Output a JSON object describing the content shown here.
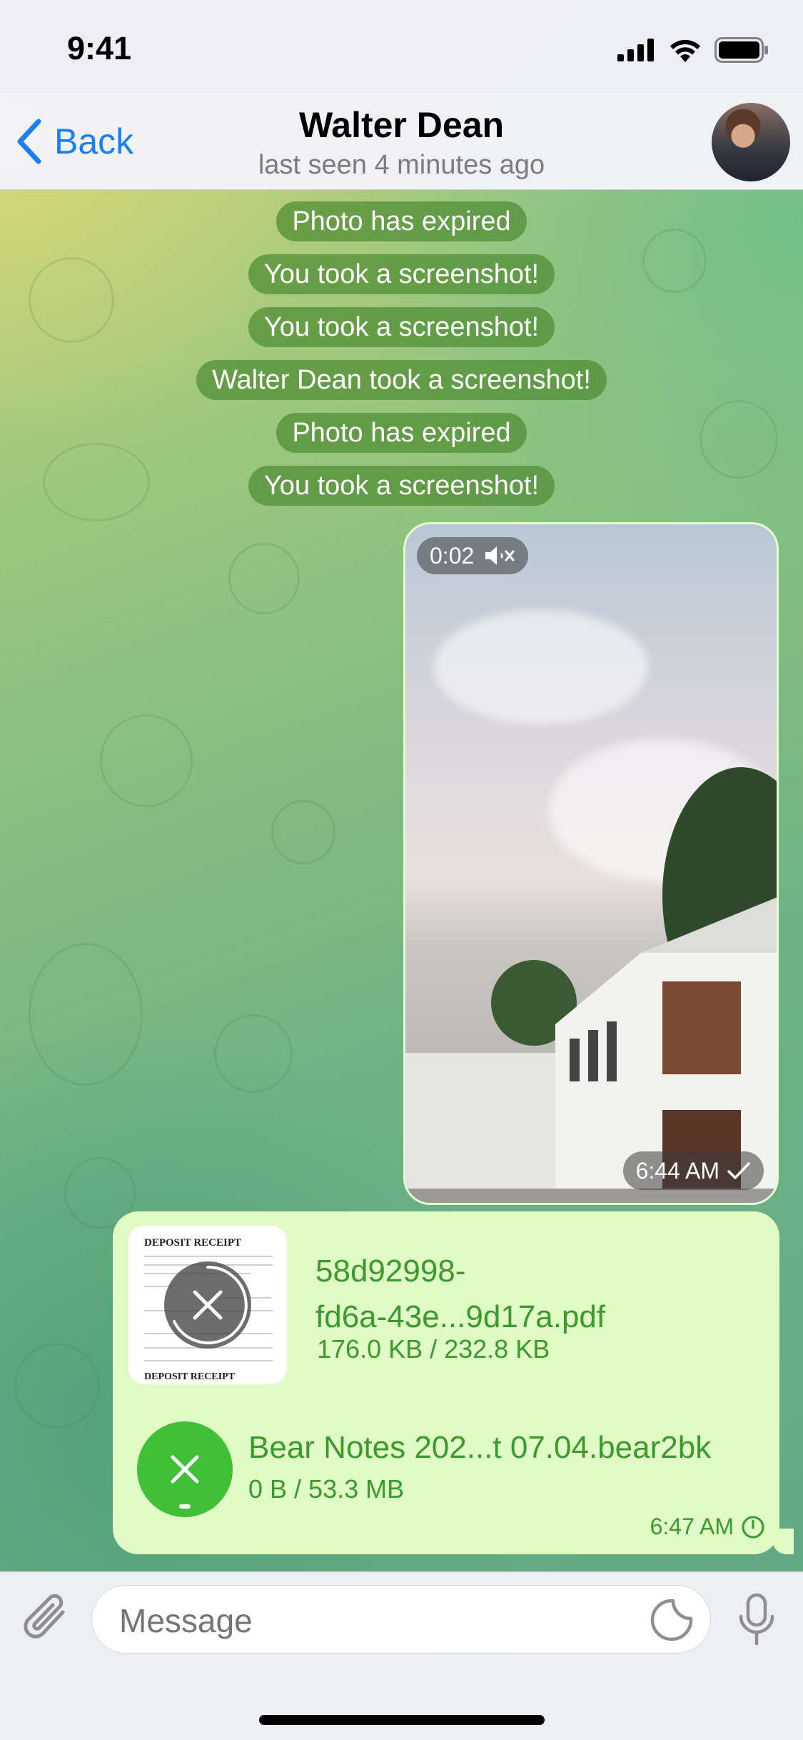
{
  "status_bar": {
    "time": "9:41"
  },
  "header": {
    "back_label": "Back",
    "title": "Walter Dean",
    "subtitle": "last seen 4 minutes ago"
  },
  "service_messages": [
    "Photo has expired",
    "You took a screenshot!",
    "You took a screenshot!",
    "Walter Dean took a screenshot!",
    "Photo has expired",
    "You took a screenshot!"
  ],
  "video_message": {
    "duration": "0:02",
    "time": "6:44 AM"
  },
  "file_message": {
    "thumbnail_title": "DEPOSIT RECEIPT",
    "file1": {
      "name_line1": "58d92998-",
      "name_line2": "fd6a-43e...9d17a.pdf",
      "size": "176.0 KB / 232.8 KB"
    },
    "file2": {
      "name": "Bear Notes 202...t 07.04.bear2bk",
      "size": "0 B / 53.3 MB"
    },
    "time": "6:47 AM"
  },
  "input": {
    "placeholder": "Message"
  },
  "colors": {
    "accent": "#1a7ff5",
    "outgoing_bubble": "#e0fbc6",
    "outgoing_text": "#3a9a2c",
    "service_bg": "#4e8c32"
  }
}
